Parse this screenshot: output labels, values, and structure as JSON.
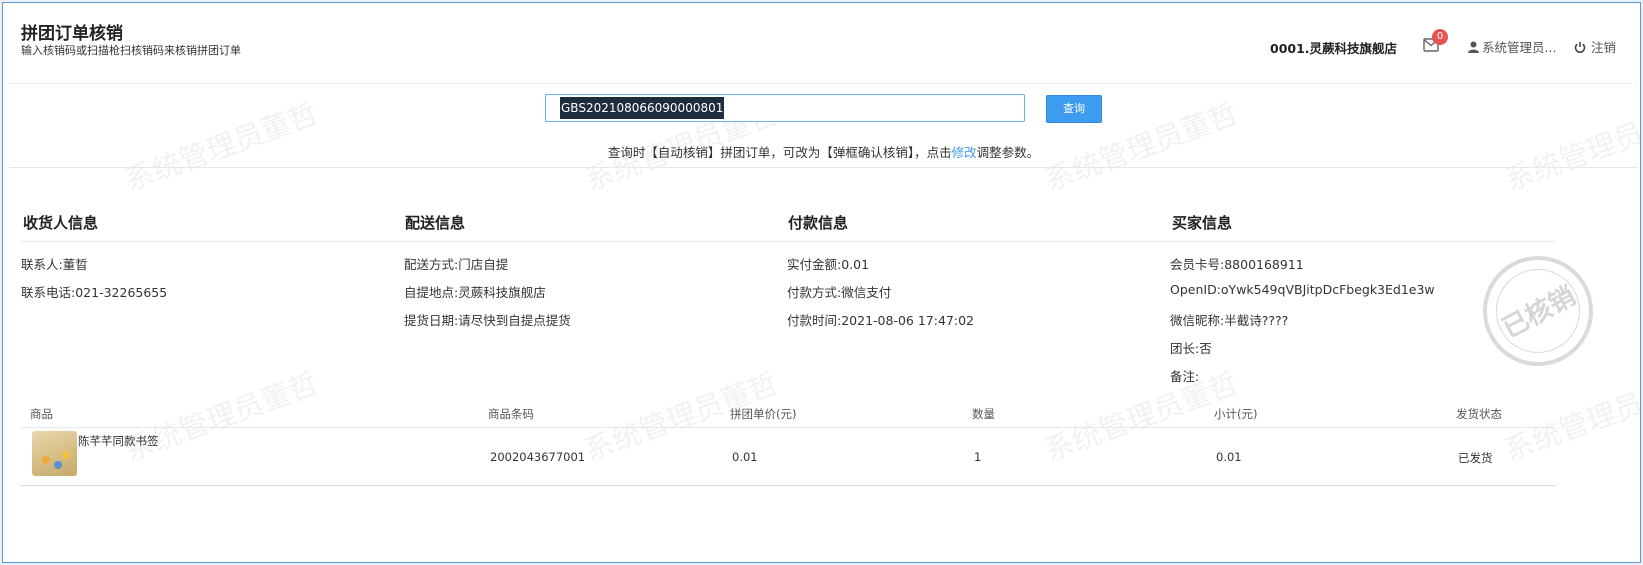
{
  "header": {
    "title": "拼团订单核销",
    "subtitle": "输入核销码或扫描枪扫核销码来核销拼团订单",
    "store": "0001.灵蕨科技旗舰店",
    "mail_count": "0",
    "user": "系统管理员...",
    "logout": "注销"
  },
  "search": {
    "value": "GBS202108066090000801",
    "button": "查询",
    "hint_prefix": "查询时【自动核销】拼团订单，可改为【弹框确认核销】，点击",
    "hint_link": "修改",
    "hint_suffix": "调整参数。"
  },
  "receiver": {
    "title": "收货人信息",
    "contact": "联系人:董晢",
    "phone": "联系电话:021-32265655"
  },
  "delivery": {
    "title": "配送信息",
    "method": "配送方式:门店自提",
    "pickup": "自提地点:灵蕨科技旗舰店",
    "date": "提货日期:请尽快到自提点提货"
  },
  "payment": {
    "title": "付款信息",
    "amount": "实付金额:0.01",
    "method": "付款方式:微信支付",
    "time": "付款时间:2021-08-06 17:47:02"
  },
  "buyer": {
    "title": "买家信息",
    "card": "会员卡号:8800168911",
    "openid": "OpenID:oYwk549qVBJitpDcFbegk3Ed1e3w",
    "nickname": "微信昵称:半截诗????",
    "leader": "团长:否",
    "note": "备注:"
  },
  "table": {
    "headers": [
      "商品",
      "商品条码",
      "拼团单价(元)",
      "数量",
      "小计(元)",
      "发货状态"
    ],
    "rows": [
      {
        "name": "陈芊芊同款书签",
        "barcode": "2002043677001",
        "price": "0.01",
        "qty": "1",
        "subtotal": "0.01",
        "status": "已发货"
      }
    ]
  },
  "stamp_text": "已核销",
  "watermark": "系统管理员董哲",
  "colors": {
    "accent": "#3d9bf0",
    "badge": "#e55353"
  }
}
